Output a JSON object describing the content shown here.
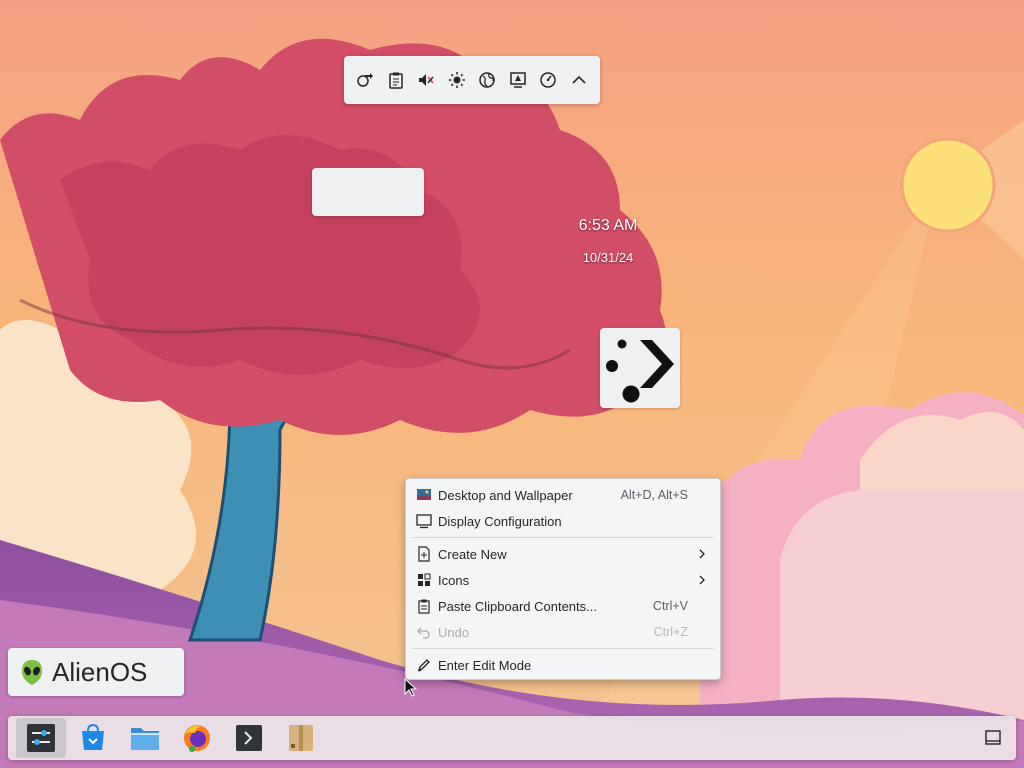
{
  "clock": {
    "time": "6:53 AM",
    "date": "10/31/24"
  },
  "tray_popup": {
    "icons": [
      "network-icon",
      "clipboard-icon",
      "volume-muted-icon",
      "brightness-icon",
      "globe-icon",
      "display-icon",
      "help-icon",
      "collapse-icon"
    ]
  },
  "branding": {
    "label": "AlienOS",
    "icon": "alien-icon"
  },
  "context_menu": {
    "items": [
      {
        "label": "Desktop and Wallpaper",
        "shortcut": "Alt+D, Alt+S",
        "icon": "wallpaper-icon",
        "enabled": true,
        "submenu": false
      },
      {
        "label": "Display Configuration",
        "shortcut": "",
        "icon": "monitor-icon",
        "enabled": true,
        "submenu": false
      },
      {
        "label": "Create New",
        "shortcut": "",
        "icon": "new-file-icon",
        "enabled": true,
        "submenu": true
      },
      {
        "label": "Icons",
        "shortcut": "",
        "icon": "grid-icon",
        "enabled": true,
        "submenu": true
      },
      {
        "label": "Paste Clipboard Contents...",
        "shortcut": "Ctrl+V",
        "icon": "paste-icon",
        "enabled": true,
        "submenu": false
      },
      {
        "label": "Undo",
        "shortcut": "Ctrl+Z",
        "icon": "undo-icon",
        "enabled": false,
        "submenu": false
      },
      {
        "label": "Enter Edit Mode",
        "shortcut": "",
        "icon": "pencil-icon",
        "enabled": true,
        "submenu": false
      }
    ]
  },
  "taskbar": {
    "apps": [
      "settings-app-icon",
      "store-app-icon",
      "file-manager-app-icon",
      "firefox-app-icon",
      "terminal-app-icon",
      "archive-app-icon"
    ],
    "active_index": 0
  },
  "colors": {
    "accent": "#3daee9",
    "menu_bg": "#f4f5f6",
    "text": "#232629",
    "disabled": "#a7aaad"
  }
}
